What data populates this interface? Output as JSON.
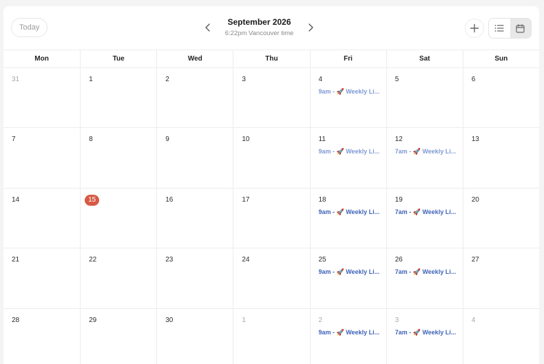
{
  "toolbar": {
    "today_label": "Today",
    "month_title": "September 2026",
    "timezone_label": "6:22pm Vancouver time",
    "icons": {
      "prev": "chevron-left-icon",
      "next": "chevron-right-icon",
      "add": "plus-icon",
      "list_view": "list-icon",
      "calendar_view": "calendar-icon"
    },
    "active_view": "calendar"
  },
  "weekdays": [
    "Mon",
    "Tue",
    "Wed",
    "Thu",
    "Fri",
    "Sat",
    "Sun"
  ],
  "colors": {
    "today_badge": "#d65a45",
    "event_past": "#7f9ad3",
    "event_future": "#3f63b8"
  },
  "weeks": [
    [
      {
        "day": "31",
        "muted": true
      },
      {
        "day": "1"
      },
      {
        "day": "2"
      },
      {
        "day": "3"
      },
      {
        "day": "4",
        "events": [
          {
            "text": "9am - 🚀 Weekly Li...",
            "past": true
          }
        ]
      },
      {
        "day": "5"
      },
      {
        "day": "6"
      }
    ],
    [
      {
        "day": "7"
      },
      {
        "day": "8"
      },
      {
        "day": "9"
      },
      {
        "day": "10"
      },
      {
        "day": "11",
        "events": [
          {
            "text": "9am - 🚀 Weekly Li...",
            "past": true
          }
        ]
      },
      {
        "day": "12",
        "events": [
          {
            "text": "7am - 🚀 Weekly Li...",
            "past": true
          }
        ]
      },
      {
        "day": "13"
      }
    ],
    [
      {
        "day": "14"
      },
      {
        "day": "15",
        "today": true
      },
      {
        "day": "16"
      },
      {
        "day": "17"
      },
      {
        "day": "18",
        "events": [
          {
            "text": "9am - 🚀 Weekly Li...",
            "past": false
          }
        ]
      },
      {
        "day": "19",
        "events": [
          {
            "text": "7am - 🚀 Weekly Li...",
            "past": false
          }
        ]
      },
      {
        "day": "20"
      }
    ],
    [
      {
        "day": "21"
      },
      {
        "day": "22"
      },
      {
        "day": "23"
      },
      {
        "day": "24"
      },
      {
        "day": "25",
        "events": [
          {
            "text": "9am - 🚀 Weekly Li...",
            "past": false
          }
        ]
      },
      {
        "day": "26",
        "events": [
          {
            "text": "7am - 🚀 Weekly Li...",
            "past": false
          }
        ]
      },
      {
        "day": "27"
      }
    ],
    [
      {
        "day": "28"
      },
      {
        "day": "29"
      },
      {
        "day": "30"
      },
      {
        "day": "1",
        "muted": true
      },
      {
        "day": "2",
        "muted": true,
        "events": [
          {
            "text": "9am - 🚀 Weekly Li...",
            "past": false
          }
        ]
      },
      {
        "day": "3",
        "muted": true,
        "events": [
          {
            "text": "7am - 🚀 Weekly Li...",
            "past": false
          }
        ]
      },
      {
        "day": "4",
        "muted": true
      }
    ]
  ]
}
